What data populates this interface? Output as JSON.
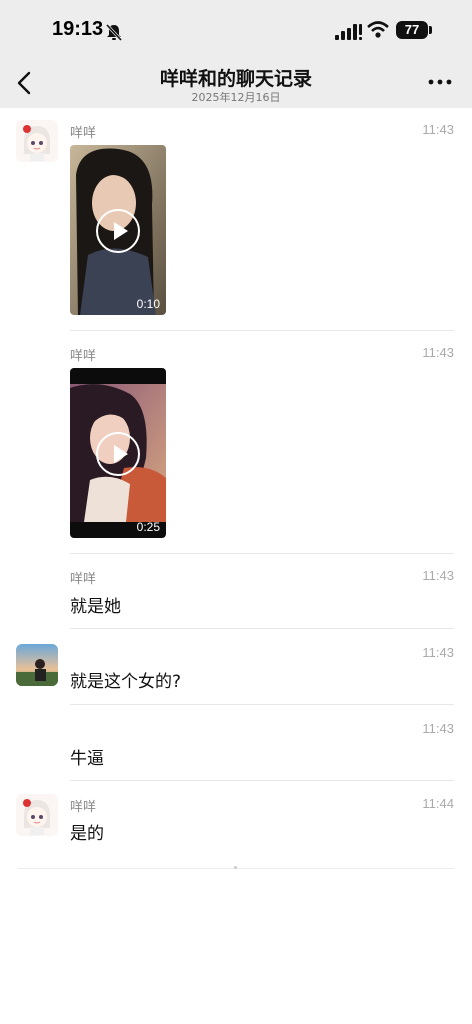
{
  "status": {
    "time": "19:13",
    "battery": "77"
  },
  "header": {
    "title": "咩咩和的聊天记录",
    "date": "2025年12月16日"
  },
  "messages": [
    {
      "sender": "咩咩",
      "time": "11:43",
      "video_duration": "0:10"
    },
    {
      "sender": "咩咩",
      "time": "11:43",
      "video_duration": "0:25"
    },
    {
      "sender": "咩咩",
      "time": "11:43",
      "text": "就是她"
    },
    {
      "time": "11:43",
      "text": "就是这个女的?"
    },
    {
      "time": "11:43",
      "text": "牛逼"
    },
    {
      "sender": "咩咩",
      "time": "11:44",
      "text": "是的"
    }
  ],
  "colors": {
    "bar_bg": "#ededed",
    "divider": "#e8e8e8"
  }
}
